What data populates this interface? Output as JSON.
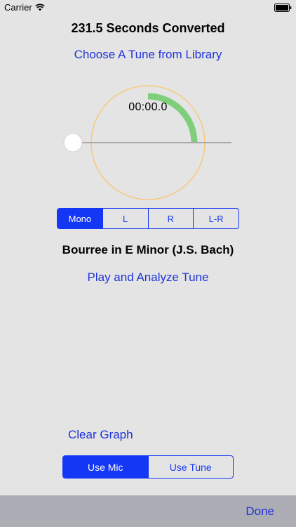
{
  "status_bar": {
    "carrier": "Carrier",
    "icons": [
      "wifi-icon",
      "battery-icon"
    ]
  },
  "header": {
    "title": "231.5 Seconds Converted",
    "choose_tune_label": "Choose A Tune from Library"
  },
  "dial": {
    "timer": "00:00.0"
  },
  "channel_selector": {
    "options": [
      "Mono",
      "L",
      "R",
      "L-R"
    ],
    "selected": "Mono"
  },
  "tune": {
    "name": "Bourree in E Minor (J.S. Bach)",
    "play_label": "Play and Analyze Tune"
  },
  "graph": {
    "clear_label": "Clear Graph"
  },
  "source_selector": {
    "options": [
      "Use Mic",
      "Use Tune"
    ],
    "selected": "Use Mic"
  },
  "toolbar": {
    "done_label": "Done"
  },
  "colors": {
    "accent": "#1436f5",
    "link": "#1f33d8",
    "background": "#e4e4e4",
    "toolbar": "#adadb5",
    "dial_ring": "#f7c97b",
    "progress_arc": "#7fcf7a"
  }
}
